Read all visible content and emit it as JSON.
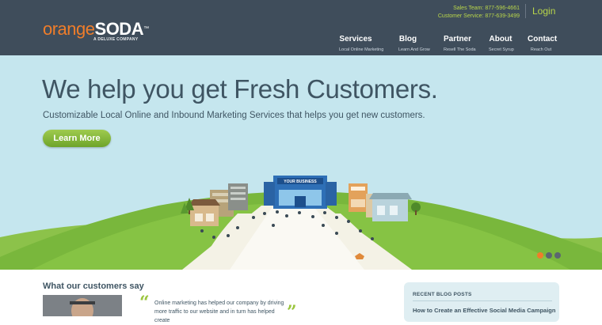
{
  "header": {
    "logo": {
      "orange": "orange",
      "soda": "SODA",
      "tm": "™",
      "sub": "A DELUXE COMPANY"
    },
    "contact": {
      "sales": "Sales Team: 877-596-4661",
      "service": "Customer Service: 877-639-3499"
    },
    "login_label": "Login",
    "nav": [
      {
        "label": "Services",
        "sub": "Local Online Marketing"
      },
      {
        "label": "Blog",
        "sub": "Learn And Grow"
      },
      {
        "label": "Partner",
        "sub": "Resell The Soda"
      },
      {
        "label": "About",
        "sub": "Secret Syrup"
      },
      {
        "label": "Contact",
        "sub": "Reach Out"
      }
    ]
  },
  "hero": {
    "title": "We help you get Fresh Customers.",
    "subtitle": "Customizable Local Online and Inbound Marketing Services that helps you get new customers.",
    "button_label": "Learn More",
    "store_sign": "YOUR BUSINESS",
    "slides": [
      {
        "active": true
      },
      {
        "active": false
      },
      {
        "active": false
      }
    ]
  },
  "testimonials": {
    "title": "What our customers say",
    "quote": "Online marketing has helped our company by driving more traffic to our website and in turn has helped create"
  },
  "blog": {
    "heading": "RECENT BLOG POSTS",
    "post": "How to Create an Effective Social Media Campaign"
  },
  "colors": {
    "header_bg": "#3f4d5b",
    "accent_orange": "#ef7d2a",
    "accent_green": "#9bc53d",
    "hero_bg": "#c5e6ee"
  }
}
